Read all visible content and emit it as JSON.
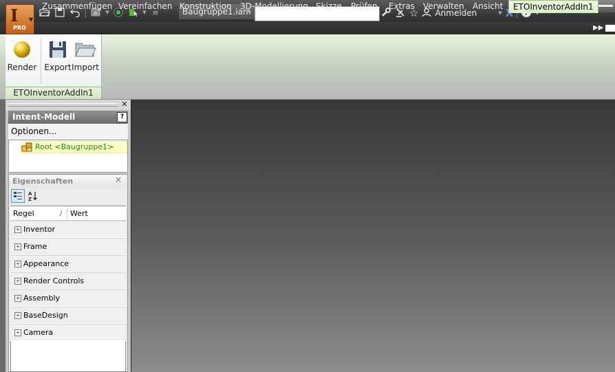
{
  "app": {
    "logo_letter": "I",
    "edition": "PRO",
    "document_name": "Baugruppe1.iam",
    "signin_label": "Anmelden"
  },
  "menu_tabs": [
    {
      "label": "Zusammenfügen"
    },
    {
      "label": "Vereinfachen"
    },
    {
      "label": "Konstruktion"
    },
    {
      "label": "3D-Modellierung"
    },
    {
      "label": "Skizze"
    },
    {
      "label": "Prüfen"
    },
    {
      "label": "Extras"
    },
    {
      "label": "Verwalten"
    },
    {
      "label": "Ansicht"
    },
    {
      "label": "ETOInventorAddIn1",
      "active": true
    }
  ],
  "ribbon": {
    "panel_title": "ETOInventorAddIn1",
    "buttons": [
      {
        "label": "Render",
        "icon": "sphere-icon"
      },
      {
        "label": "Export",
        "icon": "floppy-disk-icon"
      },
      {
        "label": "Import",
        "icon": "folder-open-icon"
      }
    ]
  },
  "intent_panel": {
    "title": "Intent-Modell",
    "options_label": "Optionen...",
    "tree_root_label": "Root <Baugruppe1>"
  },
  "properties": {
    "title": "Eigenschaften",
    "col_rule": "Regel",
    "col_value": "Wert",
    "sort_marker": "/",
    "groups": [
      "Inventor",
      "Frame",
      "Appearance",
      "Render Controls",
      "Assembly",
      "BaseDesign",
      "Camera"
    ]
  },
  "colors": {
    "active_tab": "#e4f4d8",
    "tree_item_text": "#1a8a1a",
    "tree_item_bg": "#ffffc6"
  }
}
